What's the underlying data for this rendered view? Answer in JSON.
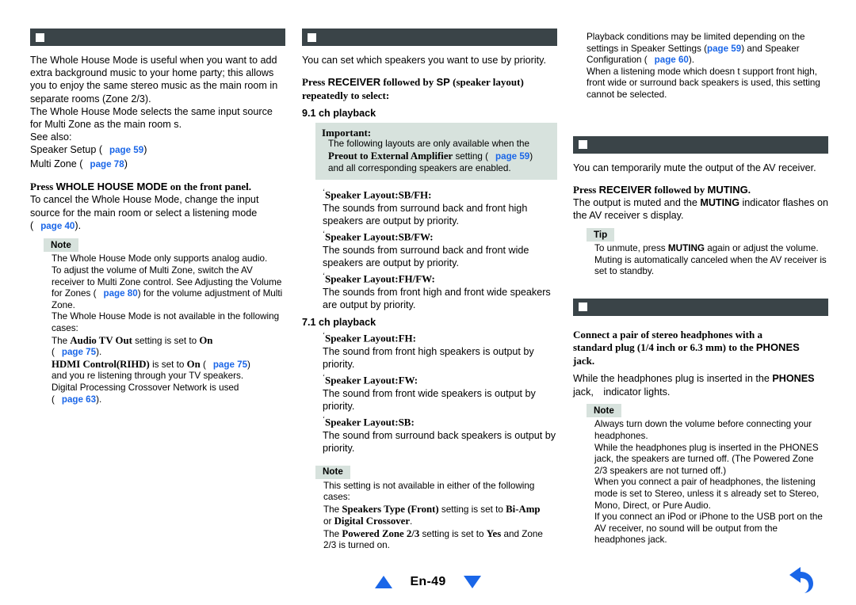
{
  "page": {
    "number_label": "En-49",
    "nav": {
      "prev_icon": "triangle-up-icon",
      "next_icon": "triangle-down-icon",
      "back_icon": "back-arrow-icon"
    },
    "accent_color": "#1a66e8",
    "header_bar_color": "#3a4448",
    "callout_bg_color": "#d7e2dd"
  },
  "columns": {
    "left": {
      "section_bar": {
        "icon": "white-square-icon",
        "title": ""
      },
      "intro": [
        "The Whole House Mode is useful when you want to add extra background music to your home party; this allows you to enjoy the same stereo music as the main room in separate rooms (Zone 2/3).",
        "The Whole House Mode selects the same input source for Multi Zone as the main room s.",
        "See also:"
      ],
      "see_also": [
        {
          "label": "Speaker Setup",
          "paren_open": "(",
          "link": "page 59",
          "paren_close": ")"
        },
        {
          "label": "Multi Zone",
          "paren_open": "(",
          "link": "page 78",
          "paren_close": ")"
        }
      ],
      "step": {
        "prefix": "Press ",
        "key": "WHOLE HOUSE MODE",
        "suffix": " on the front panel."
      },
      "step_body": "To cancel the Whole House Mode, change the input source for the main room or select a listening mode",
      "step_link": {
        "paren_open": "(",
        "link": "page 40",
        "paren_close": ")."
      },
      "note": {
        "badge": "Note",
        "lines": [
          "The Whole House Mode only supports analog audio.",
          "To adjust the volume of Multi Zone, switch the AV receiver to Multi Zone control. See Adjusting the Volume for Zones",
          "The Whole House Mode is not available in the following cases:"
        ],
        "zones_link": {
          "paren_open": "(",
          "link": "page 80",
          "paren_close": ") for the volume adjustment of Multi Zone."
        },
        "cases": [
          {
            "pre": "The ",
            "bold": "Audio TV Out",
            "mid": " setting is set to ",
            "bold2": "On",
            "link_open": "(",
            "link": "page 75",
            "link_close": ")."
          },
          {
            "pre": "",
            "bold": "HDMI Control(RIHD)",
            "mid": " is set to ",
            "bold2": "On",
            "link_open": "(",
            "link": "page 75",
            "link_close": ")",
            "tail": "and you re listening through your TV speakers."
          },
          {
            "pre": "Digital Processing Crossover Network is used",
            "link_open": "(",
            "link": "page 63",
            "link_close": ")."
          }
        ]
      }
    },
    "middle": {
      "section_bar": {
        "icon": "white-square-icon",
        "title": ""
      },
      "intro": "You can set which speakers you want to use by priority.",
      "step": {
        "prefix": "Press ",
        "key1": "RECEIVER",
        "mid": " followed by ",
        "key2": "SP",
        "suffix": " (speaker layout)",
        "line2": "repeatedly to select:"
      },
      "heading_91": "9.1 ch playback",
      "important": {
        "title": "Important:",
        "line1": "The following layouts are only available when the",
        "bold": "Preout to External Amplifier",
        "line2_mid": " setting (",
        "link": "page 59",
        "line2_end": ")",
        "line3": "and all corresponding speakers are enabled."
      },
      "layouts_91": [
        {
          "title": "Speaker Layout:SB/FH:",
          "desc": "The sounds from surround back and front high speakers are output by priority."
        },
        {
          "title": "Speaker Layout:SB/FW:",
          "desc": "The sounds from surround back and front wide speakers are output by priority."
        },
        {
          "title": "Speaker Layout:FH/FW:",
          "desc": "The sounds from front high and front wide speakers are output by priority."
        }
      ],
      "heading_71": "7.1 ch playback",
      "layouts_71": [
        {
          "title": "Speaker Layout:FH:",
          "desc": "The sound from front high speakers is output by priority."
        },
        {
          "title": "Speaker Layout:FW:",
          "desc": "The sound from front wide speakers is output by priority."
        },
        {
          "title": "Speaker Layout:SB:",
          "desc": "The sound from surround back speakers is output by priority."
        }
      ],
      "note": {
        "badge": "Note",
        "intro": "This setting is not available in either of the following cases:",
        "cases": [
          {
            "pre": "The ",
            "bold": "Speakers Type (Front)",
            "mid": " setting is set to ",
            "bold2": "Bi-Amp",
            "tail_pre": "or ",
            "bold3": "Digital Crossover",
            "tail": "."
          },
          {
            "pre": "The ",
            "bold": "Powered Zone 2/3",
            "mid": " setting is set to ",
            "bold2": "Yes",
            "tail": " and Zone 2/3 is turned on."
          }
        ]
      }
    },
    "right": {
      "top_notes": [
        {
          "pre": "Playback conditions may be limited depending on the settings in Speaker Settings (",
          "link": "page 59",
          "mid": ") and Speaker Configuration (",
          "link2": "page 60",
          "end": ")."
        },
        {
          "pre": "When a listening mode which doesn t support front high, front wide or surround back speakers is used, this setting cannot be selected."
        }
      ],
      "muting_section": {
        "section_bar": {
          "icon": "white-square-icon",
          "title": ""
        },
        "intro": "You can temporarily mute the output of the AV receiver.",
        "step": {
          "prefix": "Press ",
          "key1": "RECEIVER",
          "mid": " followed by ",
          "key2": "MUTING",
          "suffix": "."
        },
        "step_body_pre": "The output is muted and the ",
        "step_body_key": "MUTING",
        "step_body_post": " indicator flashes on the AV receiver s display.",
        "tip": {
          "badge": "Tip",
          "line1_pre": "To unmute, press ",
          "line1_key": "MUTING",
          "line1_post": " again or adjust the volume.",
          "line2": "Muting is automatically canceled when the AV receiver is set to standby."
        }
      },
      "phones_section": {
        "section_bar": {
          "icon": "white-square-icon",
          "title": ""
        },
        "step_line1": "Connect a pair of stereo headphones with a",
        "step_line2": "standard plug (1/4 inch or 6.3 mm) to the ",
        "step_key": "PHONES",
        "step_line3": "jack.",
        "body_pre": "While the headphones plug is inserted in the ",
        "body_key": "PHONES",
        "body_post": " jack, ",
        "body_end": "indicator lights.",
        "note": {
          "badge": "Note",
          "lines": [
            "Always turn down the volume before connecting your headphones.",
            "While the headphones plug is inserted in the PHONES jack, the speakers are turned off. (The Powered Zone 2/3 speakers are not turned off.)",
            "When you connect a pair of headphones, the listening mode is set to Stereo, unless it s already set to Stereo, Mono, Direct, or Pure Audio.",
            "If you connect an iPod or iPhone to the USB port on the AV receiver, no sound will be output from the headphones jack."
          ]
        }
      }
    }
  }
}
